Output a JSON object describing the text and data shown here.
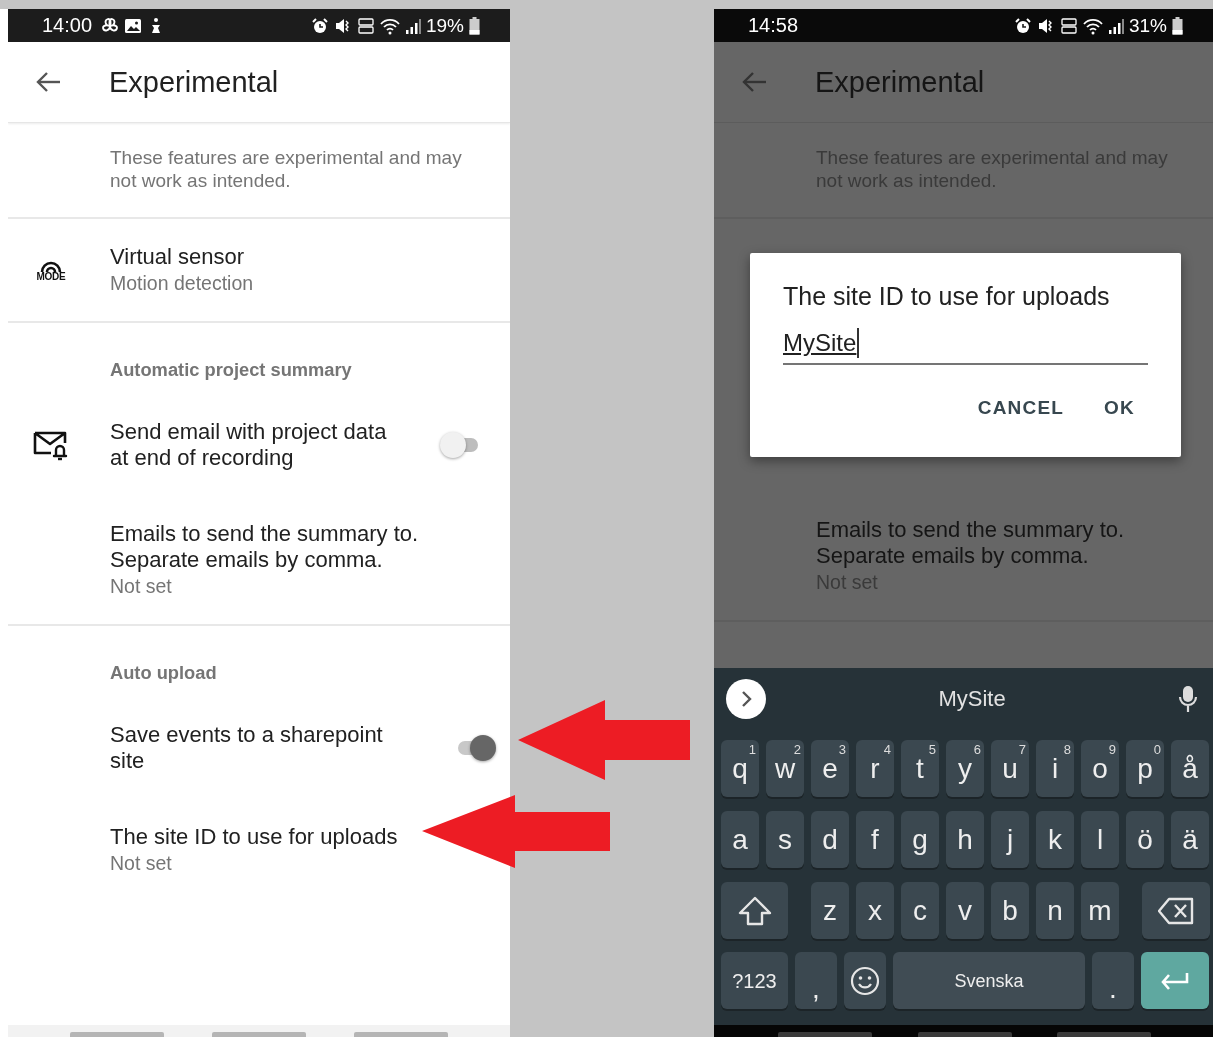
{
  "left_screen": {
    "status_bar": {
      "time": "14:00",
      "notification_icons": [
        {
          "kind": "fan"
        },
        {
          "kind": "image"
        },
        {
          "kind": "figure"
        }
      ],
      "battery": "19%"
    },
    "app_bar": {
      "title": "Experimental"
    },
    "description": "These features are experimental and may not work as intended.",
    "sections": [
      {
        "items": [
          {
            "kind": "plain",
            "icon_text": "MODE",
            "title": "Virtual sensor",
            "summary": "Motion detection"
          }
        ]
      },
      {
        "header": "Automatic project summary",
        "items": [
          {
            "kind": "switch",
            "title": "Send email with project data at end of recording",
            "checked": false
          },
          {
            "kind": "plain",
            "title": "Emails to send the summary to. Separate emails by comma.",
            "summary": "Not set"
          }
        ]
      },
      {
        "header": "Auto upload",
        "items": [
          {
            "kind": "switch",
            "title": "Save events to a sharepoint site",
            "checked": true
          },
          {
            "kind": "plain",
            "title": "The site ID to use for uploads",
            "summary": "Not set"
          }
        ]
      }
    ]
  },
  "right_screen": {
    "status_bar": {
      "time": "14:58",
      "battery": "31%"
    },
    "app_bar": {
      "title": "Experimental"
    },
    "description": "These features are experimental and may not work as intended.",
    "visible_item": {
      "title": "Emails to send the summary to. Separate emails by comma.",
      "summary": "Not set"
    },
    "dialog": {
      "title": "The site ID to use for uploads",
      "value": "MySite",
      "buttons": [
        "CANCEL",
        "OK"
      ]
    },
    "keyboard": {
      "suggestion": "MySite",
      "rows": [
        {
          "keys": [
            {
              "kind": "letter",
              "label": "q",
              "hint": "1"
            },
            {
              "kind": "letter",
              "label": "w",
              "hint": "2"
            },
            {
              "kind": "letter",
              "label": "e",
              "hint": "3"
            },
            {
              "kind": "letter",
              "label": "r",
              "hint": "4"
            },
            {
              "kind": "letter",
              "label": "t",
              "hint": "5"
            },
            {
              "kind": "letter",
              "label": "y",
              "hint": "6"
            },
            {
              "kind": "letter",
              "label": "u",
              "hint": "7"
            },
            {
              "kind": "letter",
              "label": "i",
              "hint": "8"
            },
            {
              "kind": "letter",
              "label": "o",
              "hint": "9"
            },
            {
              "kind": "letter",
              "label": "p",
              "hint": "0"
            },
            {
              "kind": "letter",
              "label": "å"
            }
          ]
        },
        {
          "keys": [
            {
              "kind": "letter",
              "label": "a"
            },
            {
              "kind": "letter",
              "label": "s"
            },
            {
              "kind": "letter",
              "label": "d"
            },
            {
              "kind": "letter",
              "label": "f"
            },
            {
              "kind": "letter",
              "label": "g"
            },
            {
              "kind": "letter",
              "label": "h"
            },
            {
              "kind": "letter",
              "label": "j"
            },
            {
              "kind": "letter",
              "label": "k"
            },
            {
              "kind": "letter",
              "label": "l"
            },
            {
              "kind": "letter",
              "label": "ö"
            },
            {
              "kind": "letter",
              "label": "ä"
            }
          ]
        },
        {
          "keys": [
            {
              "kind": "shift"
            },
            {
              "kind": "letter",
              "label": "z"
            },
            {
              "kind": "letter",
              "label": "x"
            },
            {
              "kind": "letter",
              "label": "c"
            },
            {
              "kind": "letter",
              "label": "v"
            },
            {
              "kind": "letter",
              "label": "b"
            },
            {
              "kind": "letter",
              "label": "n"
            },
            {
              "kind": "letter",
              "label": "m"
            },
            {
              "kind": "backspace"
            }
          ]
        },
        {
          "keys": [
            {
              "kind": "symbols",
              "label": "?123"
            },
            {
              "kind": "comma",
              "label": ","
            },
            {
              "kind": "emoji"
            },
            {
              "kind": "space",
              "label": "Svenska"
            },
            {
              "kind": "period",
              "label": "."
            },
            {
              "kind": "enter"
            }
          ]
        }
      ]
    }
  }
}
